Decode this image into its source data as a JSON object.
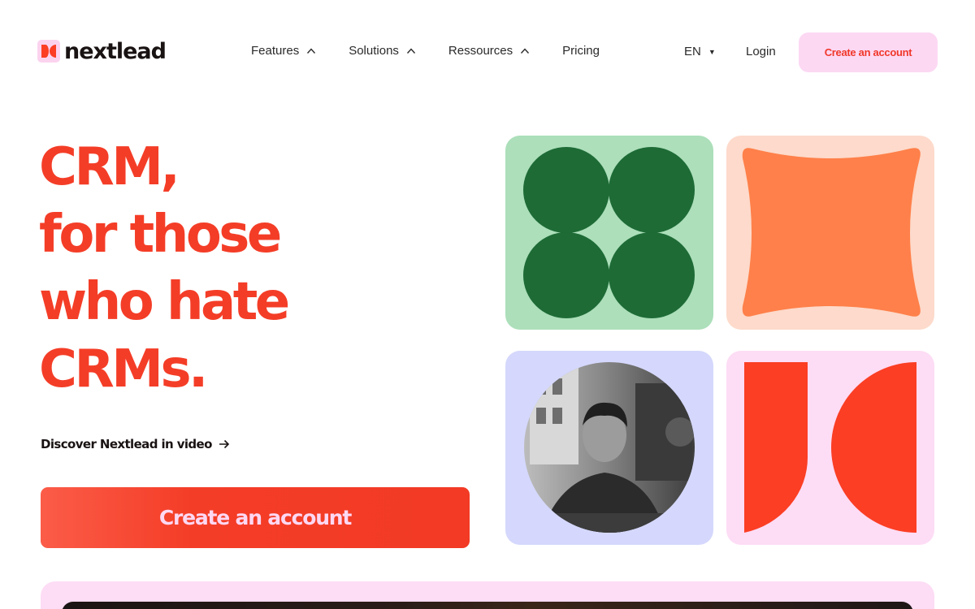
{
  "brand": {
    "name": "nextlead",
    "accent": "#f43d27",
    "pink": "#fcd8f3"
  },
  "nav": {
    "items": [
      {
        "label": "Features",
        "icon": "chevron-up-icon"
      },
      {
        "label": "Solutions",
        "icon": "chevron-up-icon"
      },
      {
        "label": "Ressources",
        "icon": "chevron-up-icon"
      },
      {
        "label": "Pricing"
      }
    ],
    "language": "EN",
    "language_icon": "caret-down-icon",
    "login": "Login",
    "cta": "Create an account"
  },
  "hero": {
    "headline": [
      "CRM,",
      "for those",
      "who hate",
      "CRMs."
    ],
    "video_link": "Discover Nextlead in video",
    "video_link_icon": "arrow-right-icon",
    "cta": "Create an account"
  },
  "tiles": [
    {
      "name": "four-circles-tile",
      "bg": "#acdfba",
      "fg": "#1e6b36"
    },
    {
      "name": "pillow-shape-tile",
      "bg": "#fddacb",
      "fg": "#ff804a"
    },
    {
      "name": "founder-photo-tile",
      "bg": "#d5d8fc",
      "fg": "#4a4a4a"
    },
    {
      "name": "logo-shape-tile",
      "bg": "#fddcf5",
      "fg": "#fb3e24"
    }
  ]
}
